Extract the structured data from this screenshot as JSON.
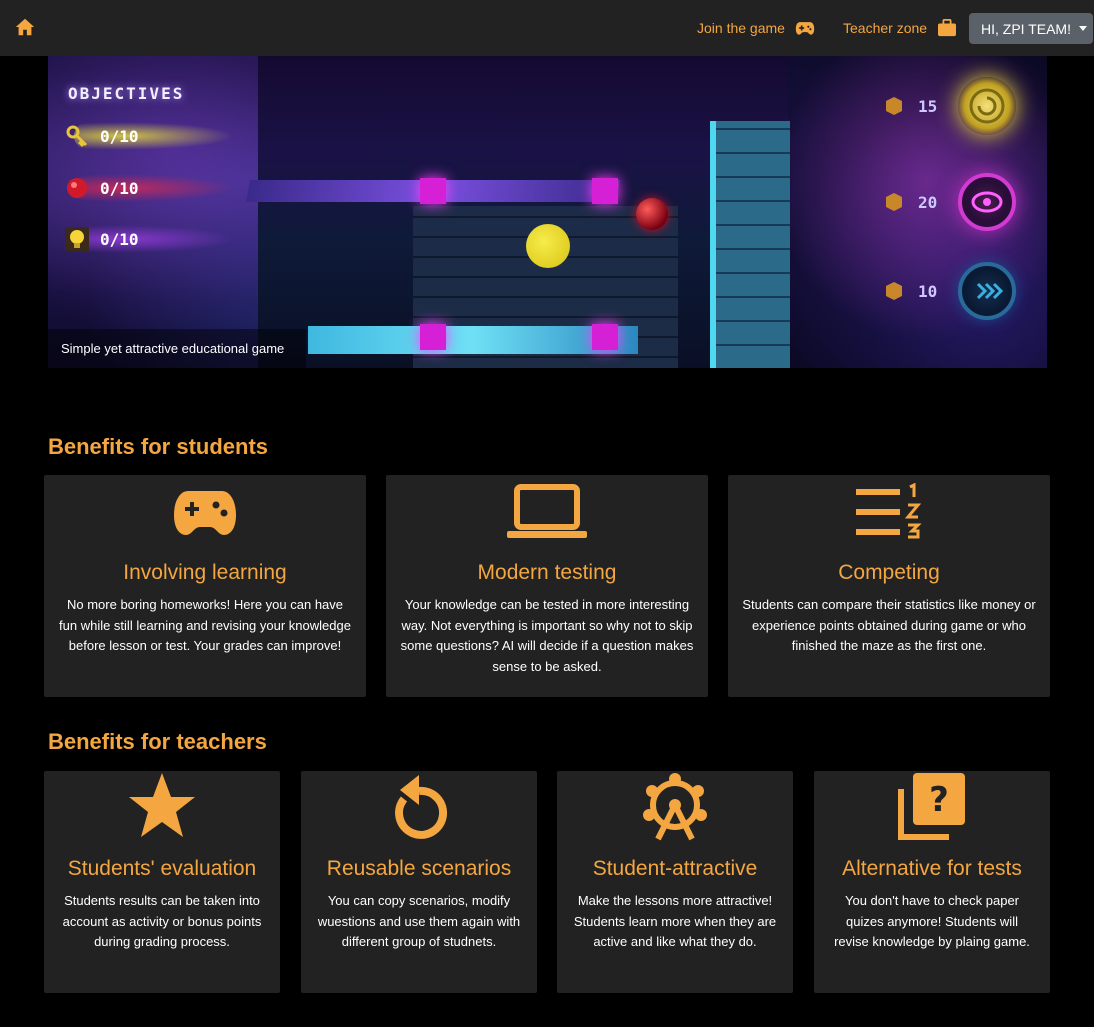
{
  "navbar": {
    "home_icon": "home-icon",
    "join_label": "Join the game",
    "join_icon": "gamepad-icon",
    "teacher_label": "Teacher zone",
    "teacher_icon": "briefcase-icon",
    "user_label": "HI, ZPI TEAM!",
    "accent_color": "#f4a640"
  },
  "hero": {
    "objectives_title": "OBJECTIVES",
    "objectives": [
      {
        "icon": "key-icon",
        "value": "0/10"
      },
      {
        "icon": "red-orb-icon",
        "value": "0/10"
      },
      {
        "icon": "bulb-icon",
        "value": "0/10"
      }
    ],
    "scores": [
      {
        "icon": "spiral-badge-icon",
        "value": "15"
      },
      {
        "icon": "eye-badge-icon",
        "value": "20"
      },
      {
        "icon": "fast-forward-badge-icon",
        "value": "10"
      }
    ],
    "caption": "Simple yet attractive educational game"
  },
  "students": {
    "title": "Benefits for students",
    "cards": [
      {
        "icon": "gamepad-icon",
        "title": "Involving learning",
        "text": "No more boring homeworks! Here you can have fun while still learning and revising your knowledge before lesson or test. Your grades can improve!"
      },
      {
        "icon": "laptop-icon",
        "title": "Modern testing",
        "text": "Your knowledge can be tested in more interesting way. Not everything is important so why not to skip some questions? AI will decide if a question makes sense to be asked."
      },
      {
        "icon": "ranking-icon",
        "title": "Competing",
        "text": "Students can compare their statistics like money or experience points obtained during game or who finished the maze as the first one."
      }
    ]
  },
  "teachers": {
    "title": "Benefits for teachers",
    "cards": [
      {
        "icon": "star-icon",
        "title": "Students' evaluation",
        "text": "Students results can be taken into account as activity or bonus points during grading process."
      },
      {
        "icon": "replay-icon",
        "title": "Reusable scenarios",
        "text": "You can copy scenarios, modify wuestions and use them again with different group of studnets."
      },
      {
        "icon": "ferris-wheel-icon",
        "title": "Student-attractive",
        "text": "Make the lessons more attractive! Students learn more when they are active and like what they do."
      },
      {
        "icon": "quiz-icon",
        "title": "Alternative for tests",
        "text": "You don't have to check paper quizes anymore! Students will revise knowledge by plaing game."
      }
    ]
  }
}
